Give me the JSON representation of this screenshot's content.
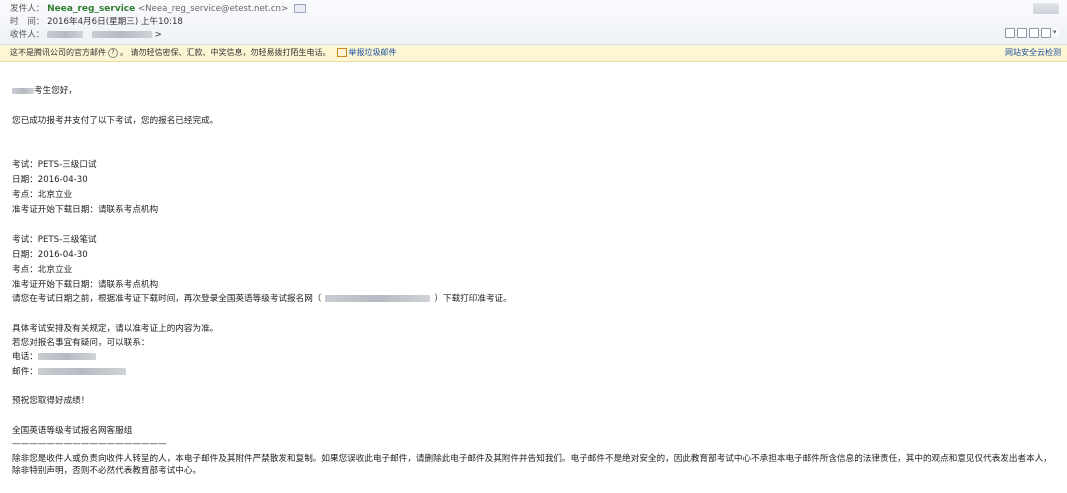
{
  "header": {
    "from_label": "发件人：",
    "from_name": "Neea_reg_service",
    "from_addr": "<Neea_reg_service@etest.net.cn>",
    "time_label": "时　间：",
    "time_value": "2016年4月6日(星期三) 上午10:18",
    "to_label": "收件人：",
    "to_suffix": ">"
  },
  "warning": {
    "text": "这不是腾讯公司的官方邮件",
    "qmark": "?",
    "caution": "。 请勿轻信密保、汇款、中奖信息，勿轻易拨打陌生电话。",
    "report_link": "举报垃圾邮件",
    "right_link": "网站安全云检测"
  },
  "email": {
    "greeting": "考生您好，",
    "intro": "您已成功报考并支付了以下考试，您的报名已经完成。",
    "exam1": {
      "exam": "考试：PETS-三级口试",
      "date": "日期：2016-04-30",
      "site": "考点：北京立业",
      "admit": "准考证开始下载日期：请联系考点机构"
    },
    "exam2": {
      "exam": "考试：PETS-三级笔试",
      "date": "日期：2016-04-30",
      "site": "考点：北京立业",
      "admit": "准考证开始下载日期：请联系考点机构"
    },
    "download_pre": "请您在考试日期之前，根据准考证下载时间，再次登录全国英语等级考试报名网（",
    "download_post": "）下载打印准考证。",
    "arrangement": "具体考试安排及有关规定，请以准考证上的内容为准。",
    "contact_intro": "若您对报名事宜有疑问，可以联系：",
    "phone_label": "电话：",
    "email_label": "邮件：",
    "wish": "预祝您取得好成绩！",
    "signature": "全国英语等级考试报名网客服组",
    "separator": "——————————————————",
    "disclaimer": "除非您是收件人或负责向收件人转呈的人，本电子邮件及其附件严禁散发和复制。如果您误收此电子邮件，请删除此电子邮件及其附件并告知我们。电子邮件不是绝对安全的，因此教育部考试中心不承担本电子邮件所含信息的法律责任，其中的观点和意见仅代表发出者本人，除非特别声明，否则不必然代表教育部考试中心。"
  }
}
